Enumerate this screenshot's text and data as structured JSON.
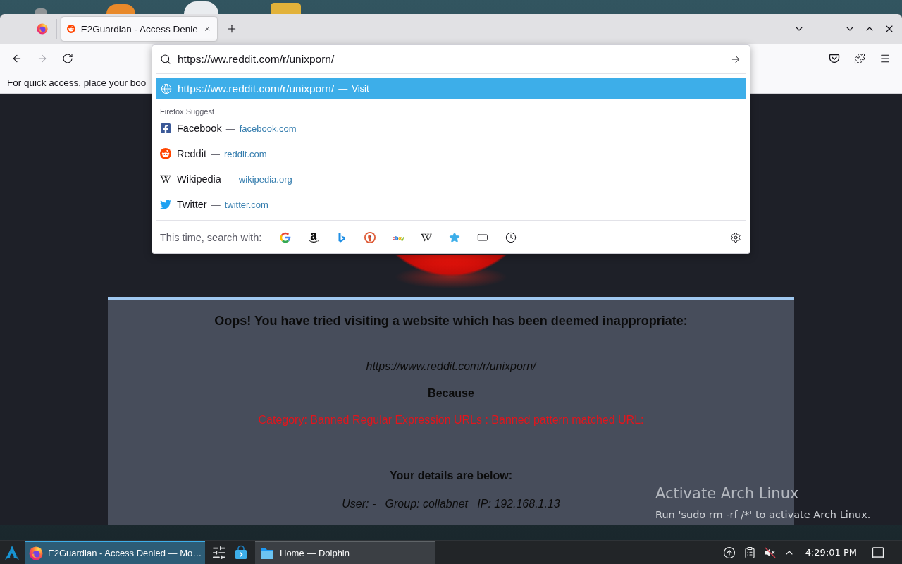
{
  "browser": {
    "tabs": [
      {
        "label": "E2Guardian - Access Denie",
        "selected": true
      }
    ],
    "navigation": {
      "back": {
        "disabled": false
      },
      "forward": {
        "disabled": true
      }
    },
    "address_bar": {
      "value": "https://ww.reddit.com/r/unixporn/"
    },
    "bookmarks_toolbar": {
      "message": "For quick access, place your boo"
    },
    "url_dropdown": {
      "heuristic": {
        "url": "https://ww.reddit.com/r/unixporn/",
        "separator": "—",
        "action": "Visit",
        "selected": true
      },
      "group_label": "Firefox Suggest",
      "suggestions": [
        {
          "title": "Facebook",
          "separator": "—",
          "url": "facebook.com",
          "selected": false
        },
        {
          "title": "Reddit",
          "separator": "—",
          "url": "reddit.com",
          "selected": false
        },
        {
          "title": "Wikipedia",
          "separator": "—",
          "url": "wikipedia.org",
          "selected": false
        },
        {
          "title": "Twitter",
          "separator": "—",
          "url": "twitter.com",
          "selected": false
        }
      ],
      "search_with_label": "This time, search with:",
      "engine_logo_text": "ebay"
    }
  },
  "page": {
    "heading": "Oops! You have tried visiting a website which has been deemed inappropriate:",
    "blocked_url": "https://www.reddit.com/r/unixporn/",
    "because": "Because",
    "reason": "Category: Banned Regular Expression URLs : Banned pattern matched URL:",
    "details_heading": "Your details are below:",
    "details": "User: -   Group: collabnet   IP: 192.168.1.13"
  },
  "activation_notice": {
    "title": "Activate Arch Linux",
    "message": "Run 'sudo rm -rf /*' to activate Arch Linux."
  },
  "taskbar": {
    "items": [
      {
        "kind": "task",
        "label": "E2Guardian - Access Denied — Mo…",
        "selected": true
      },
      {
        "kind": "launcher"
      },
      {
        "kind": "launcher"
      },
      {
        "kind": "task",
        "label": "Home — Dolphin",
        "selected": false
      }
    ],
    "clock": "4:29:01 PM"
  }
}
